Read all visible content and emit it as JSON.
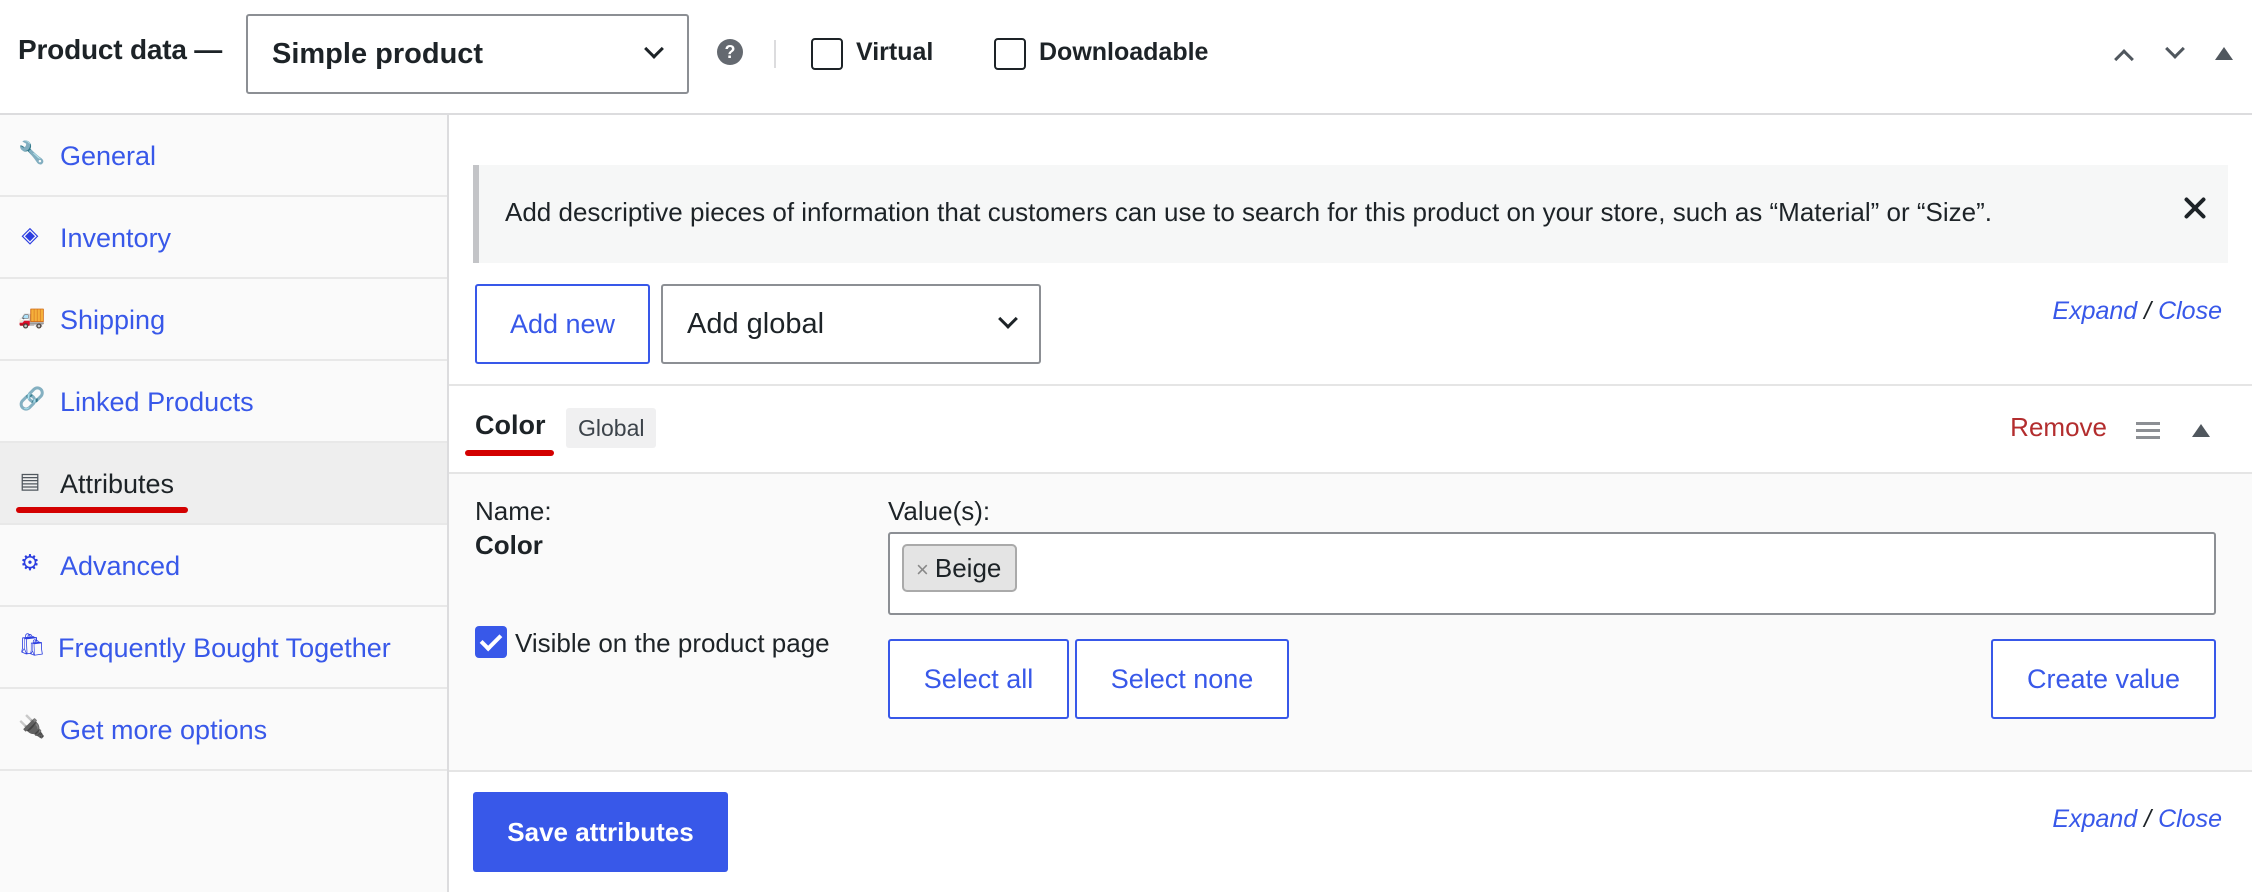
{
  "header": {
    "title": "Product data —",
    "product_type": "Simple product",
    "help_icon": "?",
    "virtual_label": "Virtual",
    "virtual_checked": false,
    "downloadable_label": "Downloadable",
    "downloadable_checked": false
  },
  "sidebar": {
    "items": [
      {
        "label": "General",
        "icon": "wrench-icon",
        "glyph": "🔧"
      },
      {
        "label": "Inventory",
        "icon": "tag-icon",
        "glyph": "◈"
      },
      {
        "label": "Shipping",
        "icon": "truck-icon",
        "glyph": "🚚"
      },
      {
        "label": "Linked Products",
        "icon": "link-icon",
        "glyph": "🔗"
      },
      {
        "label": "Attributes",
        "icon": "list-icon",
        "glyph": "▤"
      },
      {
        "label": "Advanced",
        "icon": "gear-icon",
        "glyph": "⚙"
      },
      {
        "label": "Frequently Bought Together",
        "icon": "bag-icon",
        "glyph": "🛍"
      },
      {
        "label": "Get more options",
        "icon": "plug-icon",
        "glyph": "🔌"
      }
    ],
    "active_index": 4
  },
  "notice": {
    "text": "Add descriptive pieces of information that customers can use to search for this product on your store, such as “Material” or “Size”."
  },
  "toolbar": {
    "add_new_label": "Add new",
    "add_global_value": "Add global",
    "expand_label": "Expand",
    "separator": "/",
    "close_label": "Close"
  },
  "attribute": {
    "name": "Color",
    "badge": "Global",
    "remove_label": "Remove",
    "name_label": "Name:",
    "name_value": "Color",
    "visible_label": "Visible on the product page",
    "visible_checked": true,
    "values_label": "Value(s):",
    "values": [
      "Beige"
    ],
    "token_remove": "×",
    "select_all_label": "Select all",
    "select_none_label": "Select none",
    "create_value_label": "Create value"
  },
  "footer": {
    "save_label": "Save attributes"
  },
  "colors": {
    "accent": "#3858e9",
    "danger": "#b32d2e",
    "highlight_underline": "#d30000"
  }
}
